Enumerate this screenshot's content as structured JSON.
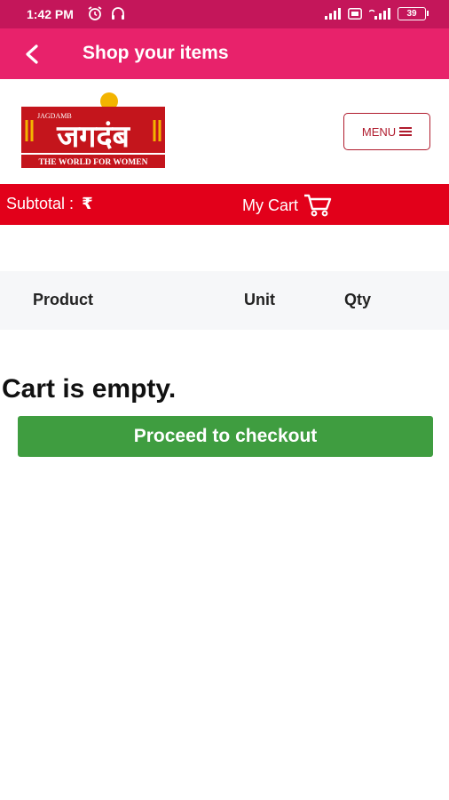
{
  "status_bar": {
    "time": "1:42 PM",
    "left_icons": [
      "alarm-icon",
      "headset-icon"
    ],
    "right_icons": [
      "signal-icon",
      "volte-icon",
      "wifi-signal-icon",
      "battery-icon"
    ],
    "battery": "39"
  },
  "app_bar": {
    "title": "Shop your items",
    "back_icon": "back-arrow-icon",
    "background": "#e8226b"
  },
  "logo": {
    "small_text": "JAGDAMB",
    "devanagari": "जगदंब",
    "tagline": "THE WORLD FOR WOMEN"
  },
  "menu_button": {
    "label": "MENU",
    "icon": "hamburger-icon"
  },
  "cart_strip": {
    "subtotal_label": "Subtotal :",
    "currency_symbol": "₹",
    "my_cart_label": "My Cart",
    "cart_icon": "shopping-cart-icon",
    "background": "#e2001a"
  },
  "table": {
    "headers": {
      "product": "Product",
      "unit": "Unit",
      "qty": "Qty"
    }
  },
  "empty_message": "Cart is empty.",
  "checkout_button": {
    "label": "Proceed to checkout",
    "color": "#3f9d40"
  }
}
